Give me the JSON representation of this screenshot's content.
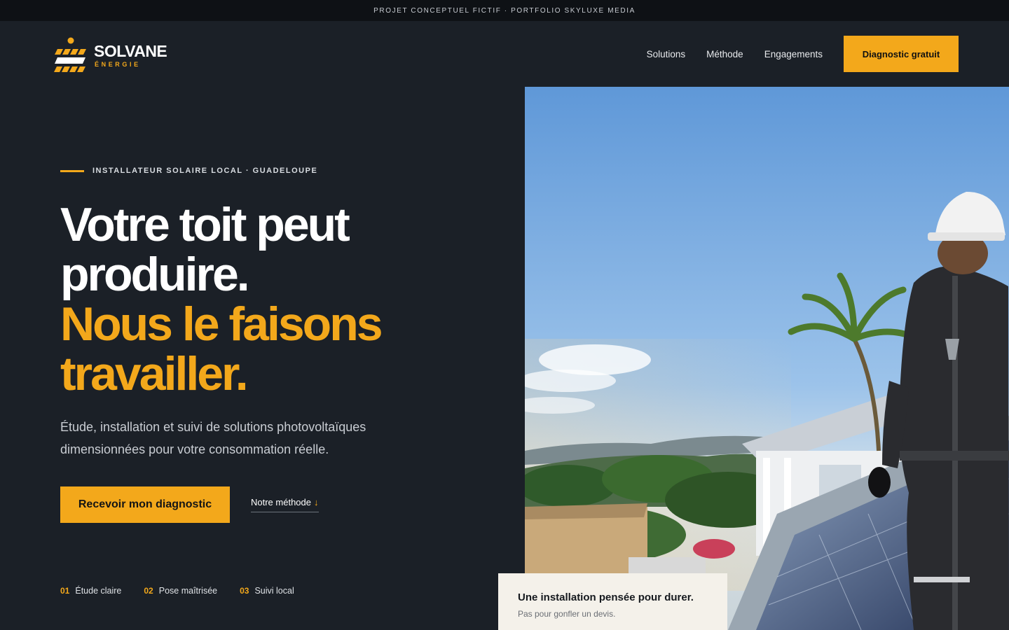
{
  "topbar": {
    "text": "PROJET CONCEPTUEL FICTIF · PORTFOLIO SKYLUXE MEDIA"
  },
  "brand": {
    "name": "SOLVANE",
    "tagline": "ÉNERGIE",
    "icon": "sun-panel-logo-icon"
  },
  "nav": {
    "items": [
      {
        "label": "Solutions"
      },
      {
        "label": "Méthode"
      },
      {
        "label": "Engagements"
      }
    ],
    "cta_label": "Diagnostic gratuit"
  },
  "hero": {
    "eyebrow": "INSTALLATEUR SOLAIRE LOCAL · GUADELOUPE",
    "headline_white_1": "Votre toit peut",
    "headline_white_2": "produire.",
    "headline_accent_1": "Nous le faisons",
    "headline_accent_2": "travailler.",
    "lead": "Étude, installation et suivi de solutions photovoltaïques dimensionnées pour votre consommation réelle.",
    "primary_cta": "Recevoir mon diagnostic",
    "secondary_cta": "Notre méthode",
    "secondary_cta_arrow": "↓"
  },
  "steps": [
    {
      "num": "01",
      "label": "Étude claire"
    },
    {
      "num": "02",
      "label": "Pose maîtrisée"
    },
    {
      "num": "03",
      "label": "Suivi local"
    }
  ],
  "image": {
    "icon": "hero-photo-solar-technician"
  },
  "card": {
    "title": "Une installation pensée pour durer.",
    "subtitle": "Pas pour gonfler un devis."
  },
  "colors": {
    "accent": "#f3a81b",
    "background": "#1b2027",
    "card": "#f4f1ea"
  }
}
